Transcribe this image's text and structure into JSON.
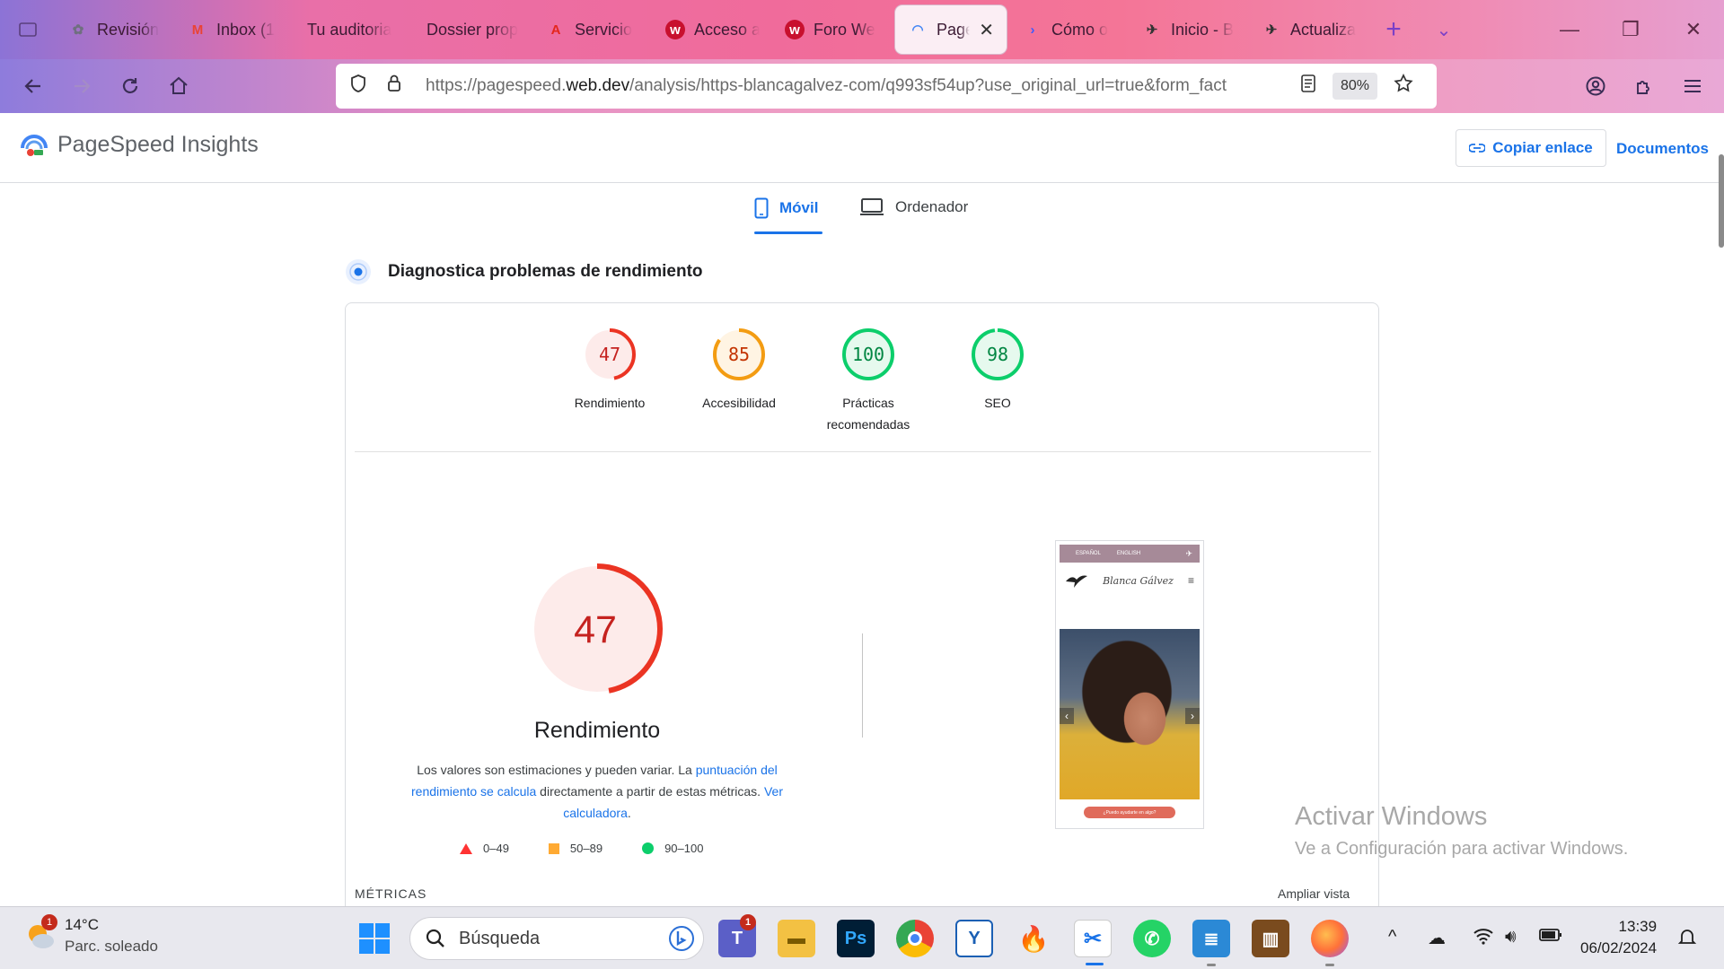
{
  "browser": {
    "tabs": [
      {
        "title": "Revisión",
        "icon": "openai-icon",
        "icon_color": "#6f6f7f"
      },
      {
        "title": "Inbox (1",
        "icon": "gmail-icon",
        "icon_color": "#ea4335"
      },
      {
        "title": "Tu auditoria",
        "icon": "none",
        "icon_color": ""
      },
      {
        "title": "Dossier prop",
        "icon": "none",
        "icon_color": ""
      },
      {
        "title": "Servicio",
        "icon": "adobe-icon",
        "icon_color": "#e4261c"
      },
      {
        "title": "Acceso a",
        "icon": "wix-icon",
        "icon_color": "#c8102e"
      },
      {
        "title": "Foro We",
        "icon": "wix-icon",
        "icon_color": "#c8102e"
      },
      {
        "title": "PageS",
        "icon": "pagespeed-icon",
        "icon_color": "#4285f4",
        "active": true
      },
      {
        "title": "Cómo o",
        "icon": "arrow-icon",
        "icon_color": "#3d5afe"
      },
      {
        "title": "Inicio - B",
        "icon": "bird-icon",
        "icon_color": "#333"
      },
      {
        "title": "Actualiza",
        "icon": "bird-icon",
        "icon_color": "#333"
      }
    ],
    "url_prefix": "https://pagespeed.",
    "url_domain": "web.dev",
    "url_rest": "/analysis/https-blancagalvez-com/q993sf54up?use_original_url=true&form_fact",
    "zoom": "80%"
  },
  "psi": {
    "app_title": "PageSpeed Insights",
    "copy_link": "Copiar enlace",
    "docs": "Documentos",
    "device_tabs": {
      "mobile": "Móvil",
      "desktop": "Ordenador"
    },
    "diagnose": "Diagnostica problemas de rendimiento",
    "scores": [
      {
        "value": 47,
        "label": "Rendimiento",
        "color": "#eb3423",
        "fill": "#fdebea"
      },
      {
        "value": 85,
        "label": "Accesibilidad",
        "color": "#f39c12",
        "fill": "#fff4e3"
      },
      {
        "value": 100,
        "label": "Prácticas recomendadas",
        "color": "#0cce6b",
        "fill": "#e6f9ee"
      },
      {
        "value": 98,
        "label": "SEO",
        "color": "#0cce6b",
        "fill": "#e6f9ee"
      }
    ],
    "main_score": 47,
    "main_title": "Rendimiento",
    "desc_1": "Los valores son estimaciones y pueden variar. La ",
    "desc_link_1": "puntuación del rendimiento se calcula",
    "desc_2": " directamente a partir de estas métricas. ",
    "desc_link_2": "Ver calculadora",
    "desc_3": ".",
    "legend": [
      "0–49",
      "50–89",
      "90–100"
    ],
    "metrics_label": "MÉTRICAS",
    "expand_view": "Ampliar vista",
    "phone_preview": {
      "lang_es": "ESPAÑOL",
      "lang_en": "ENGLISH",
      "logo_text": "Blanca Gálvez",
      "cta": "¿Puedo ayudarte en algo?"
    }
  },
  "watermark": {
    "line1": "Activar Windows",
    "line2": "Ve a Configuración para activar Windows."
  },
  "taskbar": {
    "weather_temp": "14°C",
    "weather_cond": "Parc. soleado",
    "weather_badge": "1",
    "search_placeholder": "Búsqueda",
    "teams_badge": "1",
    "time": "13:39",
    "date": "06/02/2024"
  }
}
